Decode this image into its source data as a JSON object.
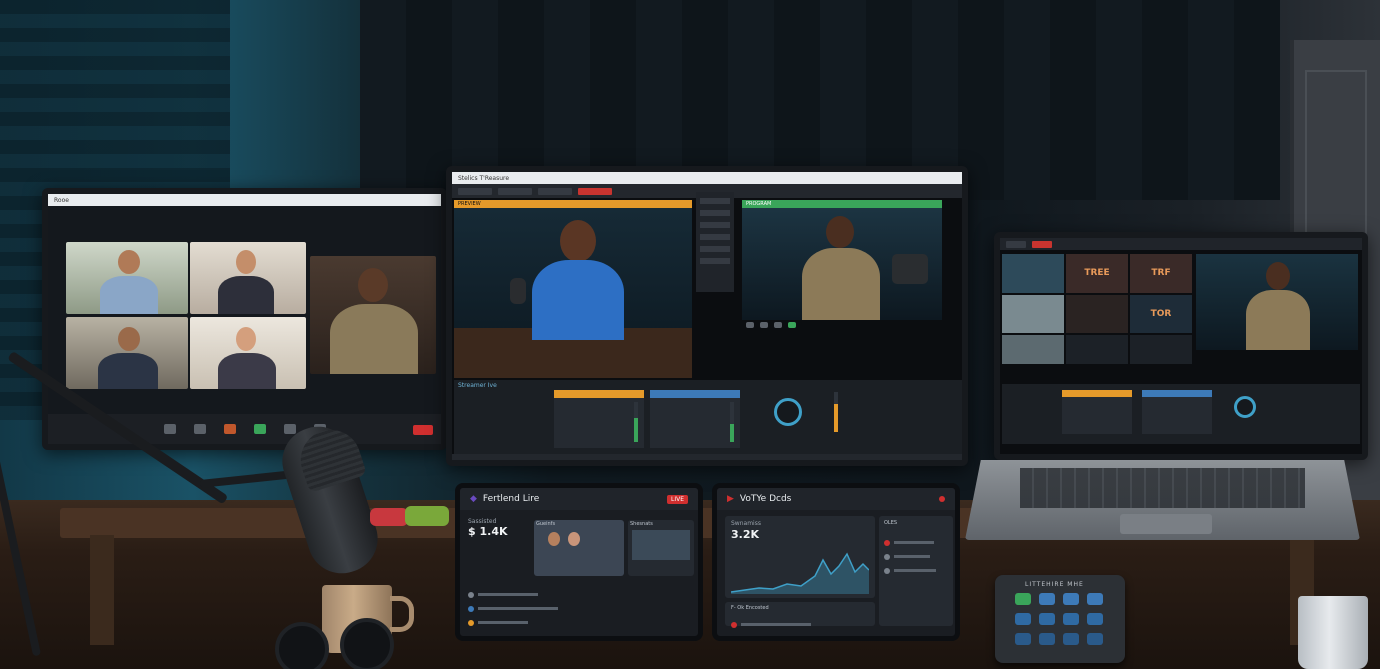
{
  "left_monitor": {
    "window_title": "Rooe"
  },
  "center_monitor": {
    "window_title": "Stelics T'Reasure",
    "preview_label": "PREVIEW",
    "program_label": "PROGRAM",
    "mixer_label": "Streamer Ive"
  },
  "left_tablet": {
    "title": "Fertlend Lire",
    "live_badge": "LIVE",
    "stat_label": "Sassisted",
    "stat_value": "$ 1.4K",
    "guest_label": "Gueinfs",
    "feed_label": "Shesnats"
  },
  "right_tablet": {
    "title": "VoTYe Dcds",
    "stat_label": "Swnamiss",
    "stat_value": "3.2K",
    "panel_label": "OLES",
    "footer_label": "F- Ok Encosted"
  },
  "stream_deck": {
    "label": "LITTEHIRE MHE"
  },
  "laptop": {
    "tile_text": [
      "TREE",
      "TRF",
      "TOR"
    ]
  },
  "colors": {
    "accent_orange": "#e59a2a",
    "accent_green": "#3aa55a",
    "accent_blue": "#3d7ab8",
    "live_red": "#d02f2f",
    "twitch_purple": "#6a4ac0"
  },
  "icons": [
    "microphone-icon",
    "camera-icon",
    "share-icon",
    "record-icon",
    "settings-icon",
    "chat-icon"
  ]
}
